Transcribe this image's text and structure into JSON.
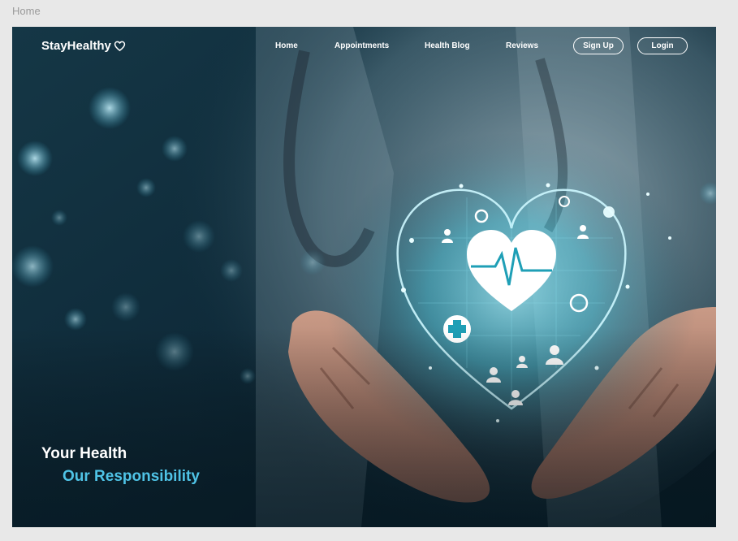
{
  "page": {
    "label": "Home"
  },
  "nav": {
    "brand": "StayHealthy",
    "brand_icon": "heart-outline-icon",
    "links": [
      "Home",
      "Appointments",
      "Health Blog",
      "Reviews"
    ],
    "signup_label": "Sign Up",
    "login_label": "Login"
  },
  "hero": {
    "line1": "Your Health",
    "line2": "Our Responsibility",
    "accent_color": "#4fc3e6",
    "image_subject": "doctor-hands-holding-glowing-heart"
  }
}
